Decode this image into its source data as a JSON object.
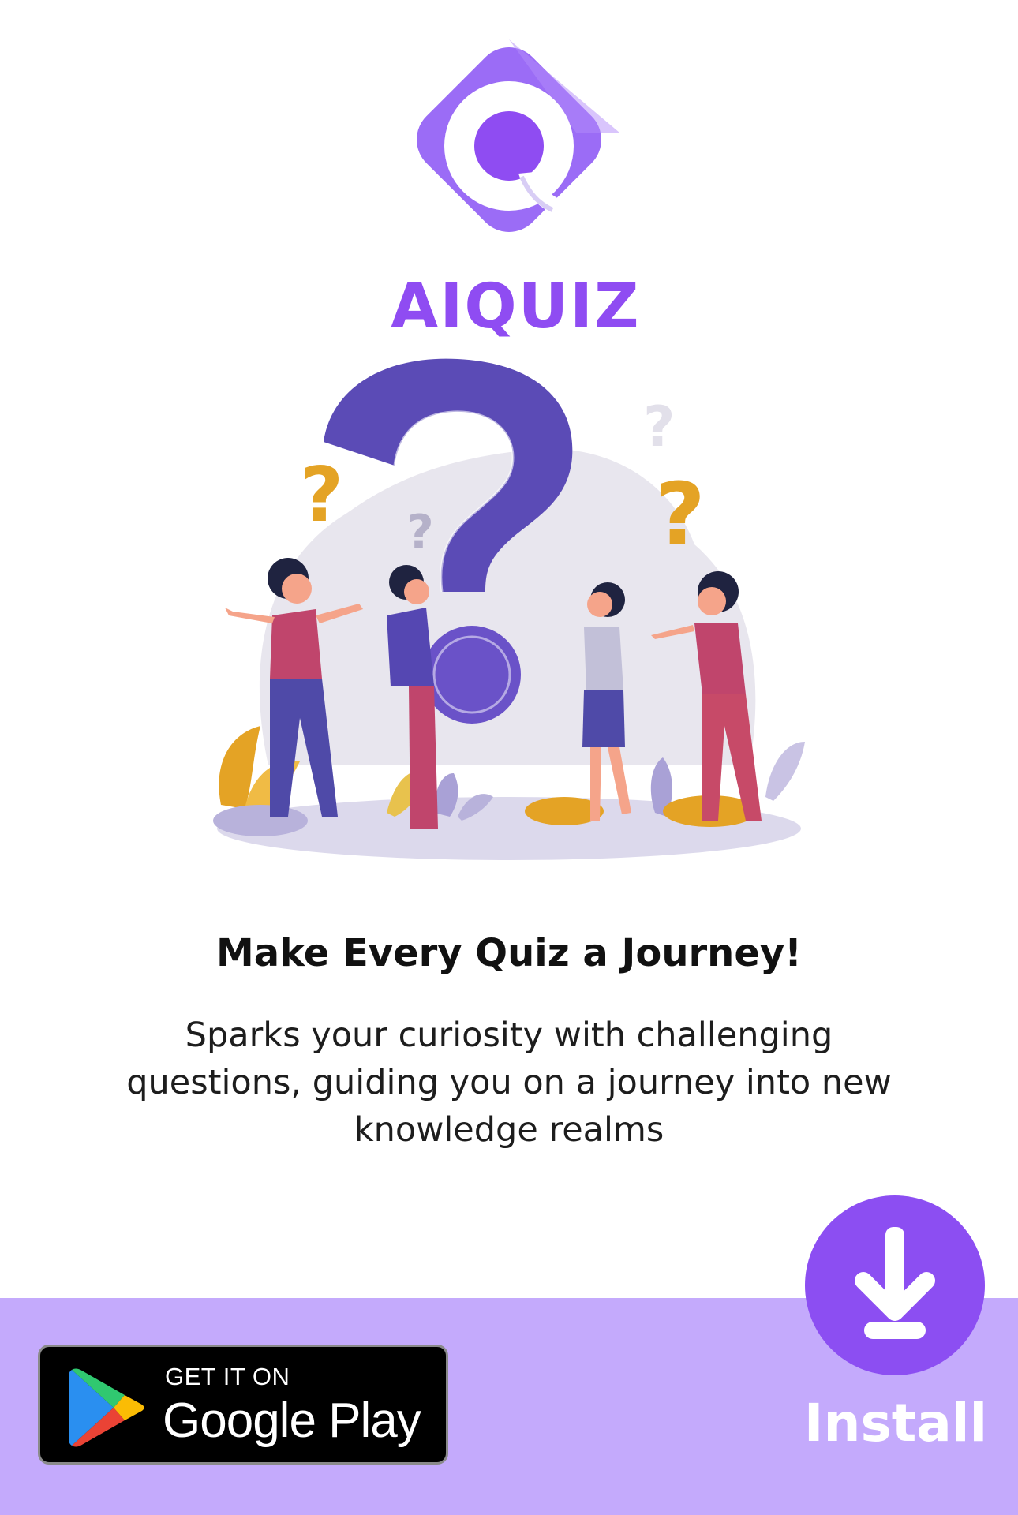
{
  "brand": {
    "name": "AIQUIZ",
    "logo_icon": "q-diamond-logo",
    "color": "#8f4cf2"
  },
  "hero": {
    "illustration": "people-question-marks-illustration"
  },
  "content": {
    "headline": "Make Every Quiz a Journey!",
    "description": "Sparks your curiosity with challenging questions, guiding you on a journey into new knowledge realms"
  },
  "store_badge": {
    "line1": "GET IT ON",
    "line2": "Google Play",
    "icon": "google-play-icon"
  },
  "install": {
    "label": "Install",
    "icon": "download-icon",
    "color": "#8c4ef2"
  },
  "colors": {
    "band": "#c4aafc",
    "accent_orange": "#e4a325",
    "accent_purple": "#6a52c8"
  }
}
